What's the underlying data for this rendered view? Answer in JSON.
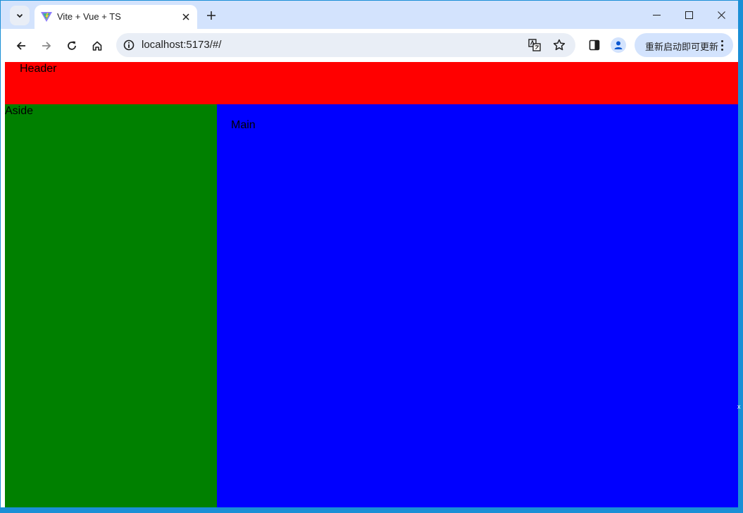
{
  "browser": {
    "tab": {
      "title": "Vite + Vue + TS"
    },
    "address": {
      "url": "localhost:5173/#/"
    },
    "update_button": {
      "label": "重新启动即可更新"
    }
  },
  "page": {
    "header_text": "Header",
    "aside_text": "Aside",
    "main_text": "Main"
  },
  "colors": {
    "header": "#ff0000",
    "aside": "#008000",
    "main": "#0000ff"
  },
  "icons": [
    "tab-search-icon",
    "vite-favicon-icon",
    "close-icon",
    "plus-icon",
    "minimize-icon",
    "maximize-icon",
    "window-close-icon",
    "back-icon",
    "forward-icon",
    "reload-icon",
    "home-icon",
    "info-icon",
    "translate-icon",
    "star-icon",
    "side-panel-icon",
    "profile-icon",
    "more-vert-icon"
  ]
}
